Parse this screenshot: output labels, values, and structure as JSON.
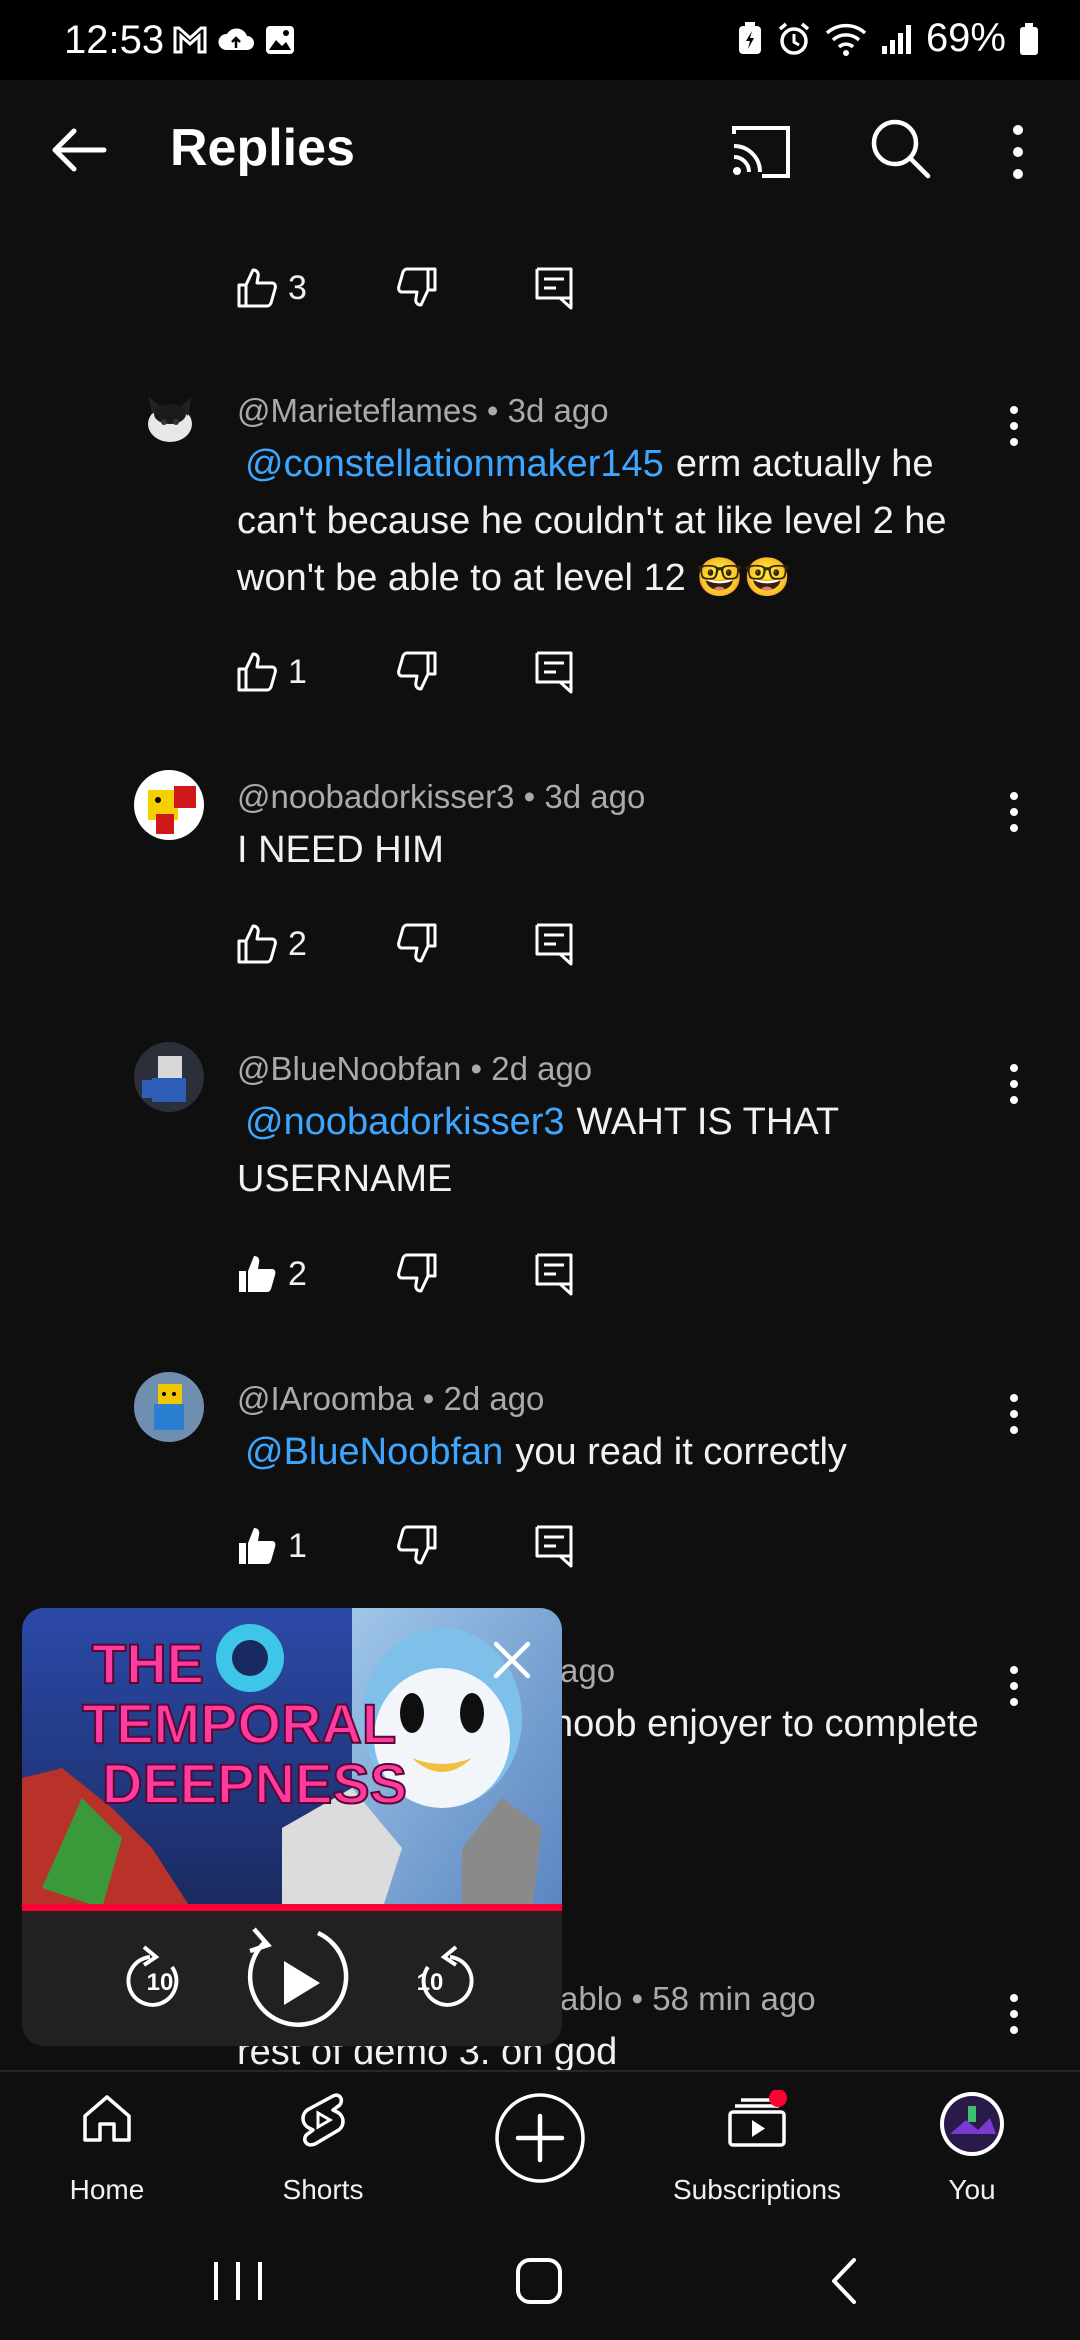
{
  "status_bar": {
    "time": "12:53",
    "battery": "69%"
  },
  "header": {
    "title": "Replies"
  },
  "top_actions": {
    "like_count": "3"
  },
  "comments": [
    {
      "author": "@Marieteflames",
      "age": "3d ago",
      "mention": "@constellationmaker145",
      "text": "erm actually he can't because he couldn't at like level 2 he won't be able to at level 12 🤓🤓",
      "likes": "1"
    },
    {
      "author": "@noobadorkisser3",
      "age": "3d ago",
      "mention": "",
      "text": "I NEED HIM",
      "likes": "2"
    },
    {
      "author": "@BlueNoobfan",
      "age": "2d ago",
      "mention": "@noobadorkisser3",
      "text": "WAHT IS THAT USERNAME",
      "likes": "2"
    },
    {
      "author": "@IAroomba",
      "age": "2d ago",
      "mention": "@BlueNoobfan",
      "text": "you read it correctly",
      "likes": "1"
    },
    {
      "author_partial": "ago",
      "text_partial": "noob enjoyer to complete"
    },
    {
      "author_partial": "ablo",
      "age": "58 min ago",
      "text_partial": "rest of demo 3. oh god"
    }
  ],
  "mini_player": {
    "thumbnail_title_line1": "THE",
    "thumbnail_title_line2": "TEMPORAL",
    "thumbnail_title_line3": "DEEPNESS",
    "rewind_label": "10",
    "forward_label": "10"
  },
  "bottom_nav": {
    "home": "Home",
    "shorts": "Shorts",
    "subscriptions": "Subscriptions",
    "you": "You"
  },
  "colors": {
    "background": "#0f0f0f",
    "mention": "#3ea6ff",
    "secondary_text": "#aaaaaa",
    "progress": "#ff0033"
  }
}
